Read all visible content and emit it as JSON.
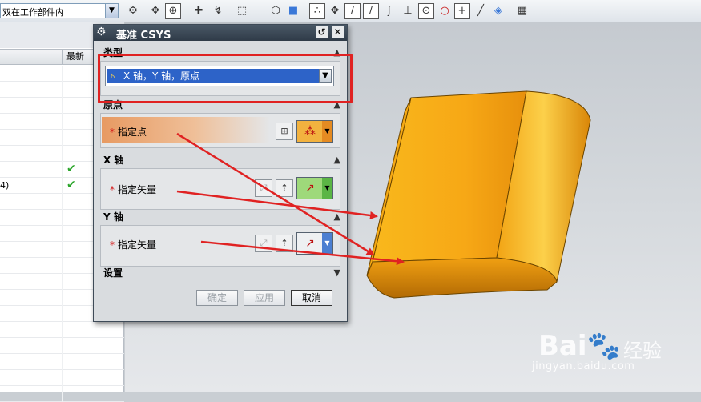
{
  "toolbar": {
    "filter_value": "双在工作部件内",
    "filter_arrow": "▼",
    "tools": [
      {
        "name": "icon-a",
        "glyph": "⚙"
      },
      {
        "name": "icon-b",
        "glyph": "✥"
      },
      {
        "name": "icon-c",
        "glyph": "⊕"
      },
      {
        "name": "icon-d",
        "glyph": "✚"
      },
      {
        "name": "icon-e",
        "glyph": "↯"
      },
      {
        "name": "icon-f",
        "glyph": "⬚"
      },
      {
        "name": "icon-g",
        "glyph": "⬡"
      },
      {
        "name": "icon-h",
        "glyph": "■"
      }
    ],
    "snap_tools": [
      {
        "name": "snap-end-icon",
        "glyph": "∴"
      },
      {
        "name": "snap-mid-icon",
        "glyph": "✥"
      },
      {
        "name": "snap-line-icon",
        "glyph": "/"
      },
      {
        "name": "snap-line2-icon",
        "glyph": "/"
      },
      {
        "name": "snap-curve-icon",
        "glyph": "ʃ"
      },
      {
        "name": "snap-intersect-icon",
        "glyph": "⊥"
      },
      {
        "name": "snap-center-icon",
        "glyph": "⊙"
      },
      {
        "name": "snap-circle-icon",
        "glyph": "○"
      },
      {
        "name": "snap-point-icon",
        "glyph": "+"
      },
      {
        "name": "snap-pen-icon",
        "glyph": "╱"
      },
      {
        "name": "snap-face-icon",
        "glyph": "◈"
      },
      {
        "name": "grid-icon",
        "glyph": "▦"
      }
    ]
  },
  "navigator": {
    "latest_header": "最新",
    "rows": [
      {
        "name": "",
        "check": ""
      },
      {
        "name": "",
        "check": ""
      },
      {
        "name": "",
        "check": ""
      },
      {
        "name": "",
        "check": ""
      },
      {
        "name": "",
        "check": ""
      },
      {
        "name": "",
        "check": ""
      },
      {
        "name": "",
        "check": "✔"
      },
      {
        "name": "4)",
        "check": "✔"
      },
      {
        "name": "",
        "check": ""
      },
      {
        "name": "",
        "check": ""
      },
      {
        "name": "",
        "check": ""
      },
      {
        "name": "",
        "check": ""
      },
      {
        "name": "",
        "check": ""
      },
      {
        "name": "",
        "check": ""
      },
      {
        "name": "",
        "check": ""
      },
      {
        "name": "",
        "check": ""
      },
      {
        "name": "",
        "check": ""
      },
      {
        "name": "",
        "check": ""
      },
      {
        "name": "",
        "check": ""
      },
      {
        "name": "",
        "check": ""
      },
      {
        "name": "",
        "check": ""
      }
    ]
  },
  "dialog": {
    "title": "基准 CSYS",
    "reset_glyph": "↺",
    "close_glyph": "✕",
    "type_group": {
      "label": "类型",
      "selected": "X 轴，Y 轴，原点",
      "collapse_glyph": "▲"
    },
    "origin_group": {
      "label": "原点",
      "field_label": "指定点",
      "collapse_glyph": "▲"
    },
    "x_group": {
      "label": "X 轴",
      "field_label": "指定矢量",
      "collapse_glyph": "▲"
    },
    "y_group": {
      "label": "Y 轴",
      "field_label": "指定矢量",
      "collapse_glyph": "▲"
    },
    "settings_group": {
      "label": "设置",
      "collapse_glyph": "▼"
    },
    "required_mark": "*",
    "buttons": {
      "ok": "确定",
      "apply": "应用",
      "cancel": "取消"
    }
  },
  "watermark": {
    "brand_left": "Bai",
    "brand_paw": "🐾",
    "brand_right": "经验",
    "url": "jingyan.baidu.com"
  },
  "colors": {
    "highlight_red": "#e02222",
    "selection_blue": "#2d63c8",
    "part_orange": "#f7a816"
  }
}
